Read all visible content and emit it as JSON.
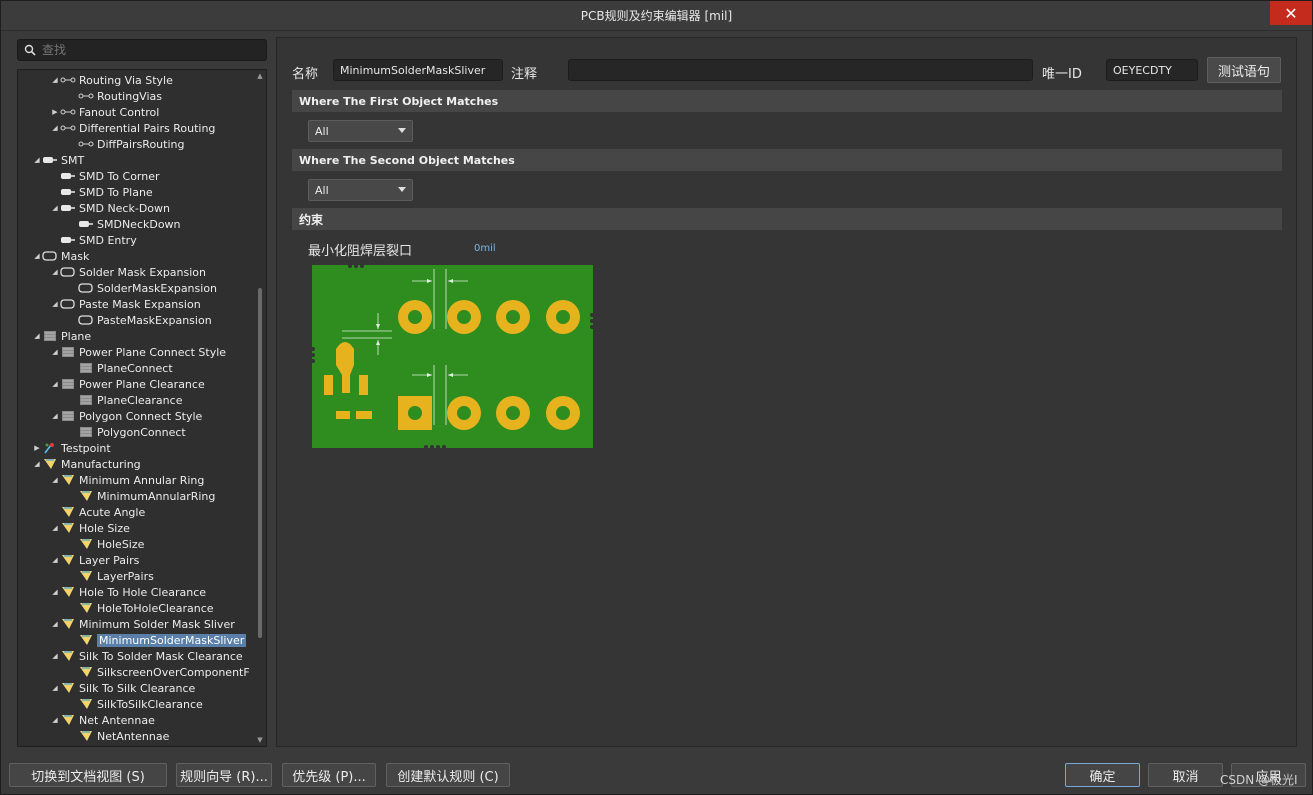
{
  "window": {
    "title": "PCB规则及约束编辑器 [mil]",
    "close_label": "✕"
  },
  "search": {
    "placeholder": "查找"
  },
  "tree": [
    {
      "label": "Routing Via Style",
      "depth": 1,
      "arrow": "down",
      "icon": "routing-icon"
    },
    {
      "label": "RoutingVias",
      "depth": 2,
      "arrow": "",
      "icon": "routing-icon"
    },
    {
      "label": "Fanout Control",
      "depth": 1,
      "arrow": "right",
      "icon": "routing-icon"
    },
    {
      "label": "Differential Pairs Routing",
      "depth": 1,
      "arrow": "down",
      "icon": "routing-icon"
    },
    {
      "label": "DiffPairsRouting",
      "depth": 2,
      "arrow": "",
      "icon": "routing-icon"
    },
    {
      "label": "SMT",
      "depth": 0,
      "arrow": "down",
      "icon": "smt-icon"
    },
    {
      "label": "SMD To Corner",
      "depth": 1,
      "arrow": "",
      "icon": "smt-icon"
    },
    {
      "label": "SMD To Plane",
      "depth": 1,
      "arrow": "",
      "icon": "smt-icon"
    },
    {
      "label": "SMD Neck-Down",
      "depth": 1,
      "arrow": "down",
      "icon": "smt-icon"
    },
    {
      "label": "SMDNeckDown",
      "depth": 2,
      "arrow": "",
      "icon": "smt-icon"
    },
    {
      "label": "SMD Entry",
      "depth": 1,
      "arrow": "",
      "icon": "smt-icon"
    },
    {
      "label": "Mask",
      "depth": 0,
      "arrow": "down",
      "icon": "mask-icon"
    },
    {
      "label": "Solder Mask Expansion",
      "depth": 1,
      "arrow": "down",
      "icon": "mask-icon"
    },
    {
      "label": "SolderMaskExpansion",
      "depth": 2,
      "arrow": "",
      "icon": "mask-icon"
    },
    {
      "label": "Paste Mask Expansion",
      "depth": 1,
      "arrow": "down",
      "icon": "mask-icon"
    },
    {
      "label": "PasteMaskExpansion",
      "depth": 2,
      "arrow": "",
      "icon": "mask-icon"
    },
    {
      "label": "Plane",
      "depth": 0,
      "arrow": "down",
      "icon": "plane-icon"
    },
    {
      "label": "Power Plane Connect Style",
      "depth": 1,
      "arrow": "down",
      "icon": "plane-icon"
    },
    {
      "label": "PlaneConnect",
      "depth": 2,
      "arrow": "",
      "icon": "plane-icon"
    },
    {
      "label": "Power Plane Clearance",
      "depth": 1,
      "arrow": "down",
      "icon": "plane-icon"
    },
    {
      "label": "PlaneClearance",
      "depth": 2,
      "arrow": "",
      "icon": "plane-icon"
    },
    {
      "label": "Polygon Connect Style",
      "depth": 1,
      "arrow": "down",
      "icon": "plane-icon"
    },
    {
      "label": "PolygonConnect",
      "depth": 2,
      "arrow": "",
      "icon": "plane-icon"
    },
    {
      "label": "Testpoint",
      "depth": 0,
      "arrow": "right",
      "icon": "testpoint-icon"
    },
    {
      "label": "Manufacturing",
      "depth": 0,
      "arrow": "down",
      "icon": "manufacturing-icon"
    },
    {
      "label": "Minimum Annular Ring",
      "depth": 1,
      "arrow": "down",
      "icon": "manufacturing-icon"
    },
    {
      "label": "MinimumAnnularRing",
      "depth": 2,
      "arrow": "",
      "icon": "manufacturing-icon"
    },
    {
      "label": "Acute Angle",
      "depth": 1,
      "arrow": "",
      "icon": "manufacturing-icon"
    },
    {
      "label": "Hole Size",
      "depth": 1,
      "arrow": "down",
      "icon": "manufacturing-icon"
    },
    {
      "label": "HoleSize",
      "depth": 2,
      "arrow": "",
      "icon": "manufacturing-icon"
    },
    {
      "label": "Layer Pairs",
      "depth": 1,
      "arrow": "down",
      "icon": "manufacturing-icon"
    },
    {
      "label": "LayerPairs",
      "depth": 2,
      "arrow": "",
      "icon": "manufacturing-icon"
    },
    {
      "label": "Hole To Hole Clearance",
      "depth": 1,
      "arrow": "down",
      "icon": "manufacturing-icon"
    },
    {
      "label": "HoleToHoleClearance",
      "depth": 2,
      "arrow": "",
      "icon": "manufacturing-icon"
    },
    {
      "label": "Minimum Solder Mask Sliver",
      "depth": 1,
      "arrow": "down",
      "icon": "manufacturing-icon"
    },
    {
      "label": "MinimumSolderMaskSliver",
      "depth": 2,
      "arrow": "",
      "icon": "manufacturing-icon",
      "selected": true
    },
    {
      "label": "Silk To Solder Mask Clearance",
      "depth": 1,
      "arrow": "down",
      "icon": "manufacturing-icon"
    },
    {
      "label": "SilkscreenOverComponentF",
      "depth": 2,
      "arrow": "",
      "icon": "manufacturing-icon"
    },
    {
      "label": "Silk To Silk Clearance",
      "depth": 1,
      "arrow": "down",
      "icon": "manufacturing-icon"
    },
    {
      "label": "SilkToSilkClearance",
      "depth": 2,
      "arrow": "",
      "icon": "manufacturing-icon"
    },
    {
      "label": "Net Antennae",
      "depth": 1,
      "arrow": "down",
      "icon": "manufacturing-icon"
    },
    {
      "label": "NetAntennae",
      "depth": 2,
      "arrow": "",
      "icon": "manufacturing-icon"
    }
  ],
  "rule": {
    "name_label": "名称",
    "name_value": "MinimumSolderMaskSliver",
    "comment_label": "注释",
    "comment_value": "",
    "uid_label": "唯一ID",
    "uid_value": "OEYECDTY",
    "test_button": "测试语句"
  },
  "first_match": {
    "header": "Where The First Object Matches",
    "value": "All"
  },
  "second_match": {
    "header": "Where The Second Object Matches",
    "value": "All"
  },
  "constraints": {
    "header": "约束",
    "label": "最小化阻焊层裂口",
    "value": "0mil"
  },
  "bottom": {
    "switch_view": "切换到文档视图 (S)",
    "rule_wizard": "规则向导 (R)...",
    "priority": "优先级 (P)...",
    "create_default": "创建默认规则 (C)",
    "ok": "确定",
    "cancel": "取消",
    "apply": "应用"
  },
  "watermark": "CSDN @极光I"
}
